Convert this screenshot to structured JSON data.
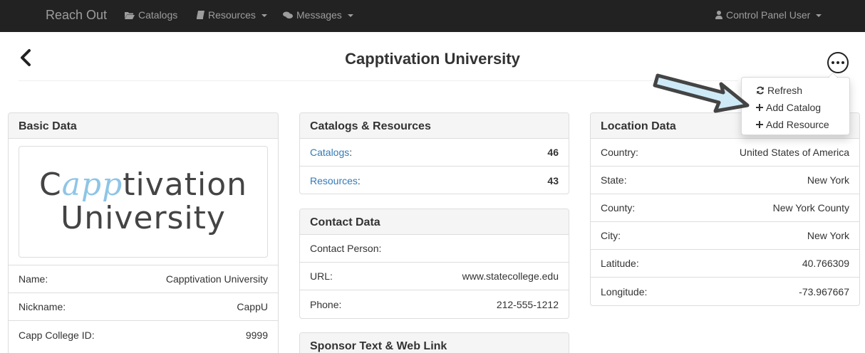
{
  "navbar": {
    "brand": "Reach Out",
    "catalogs": "Catalogs",
    "resources": "Resources",
    "messages": "Messages",
    "user": "Control Panel User"
  },
  "header": {
    "title": "Capptivation University"
  },
  "menu": {
    "refresh": "Refresh",
    "add_catalog": "Add Catalog",
    "add_resource": "Add Resource"
  },
  "basic": {
    "heading": "Basic Data",
    "logo": {
      "c": "C",
      "app": "app",
      "tivation": "tivation",
      "line2": "University"
    },
    "rows": [
      {
        "label": "Name:",
        "value": "Capptivation University"
      },
      {
        "label": "Nickname:",
        "value": "CappU"
      },
      {
        "label": "Capp College ID:",
        "value": "9999"
      }
    ]
  },
  "catres": {
    "heading": "Catalogs & Resources",
    "rows": [
      {
        "label": "Catalogs",
        "colon": ":",
        "value": "46"
      },
      {
        "label": "Resources",
        "colon": ":",
        "value": "43"
      }
    ]
  },
  "contact": {
    "heading": "Contact Data",
    "rows": [
      {
        "label": "Contact Person:",
        "value": ""
      },
      {
        "label": "URL:",
        "value": "www.statecollege.edu"
      },
      {
        "label": "Phone:",
        "value": "212-555-1212"
      }
    ]
  },
  "sponsor": {
    "heading": "Sponsor Text & Web Link"
  },
  "location": {
    "heading": "Location Data",
    "rows": [
      {
        "label": "Country:",
        "value": "United States of America"
      },
      {
        "label": "State:",
        "value": "New York"
      },
      {
        "label": "County:",
        "value": "New York County"
      },
      {
        "label": "City:",
        "value": "New York"
      },
      {
        "label": "Latitude:",
        "value": "40.766309"
      },
      {
        "label": "Longitude:",
        "value": "-73.967667"
      }
    ]
  },
  "colors": {
    "navbar_bg": "#222222",
    "link": "#337ab7",
    "annotation_arrow": "#cfeaf7"
  }
}
